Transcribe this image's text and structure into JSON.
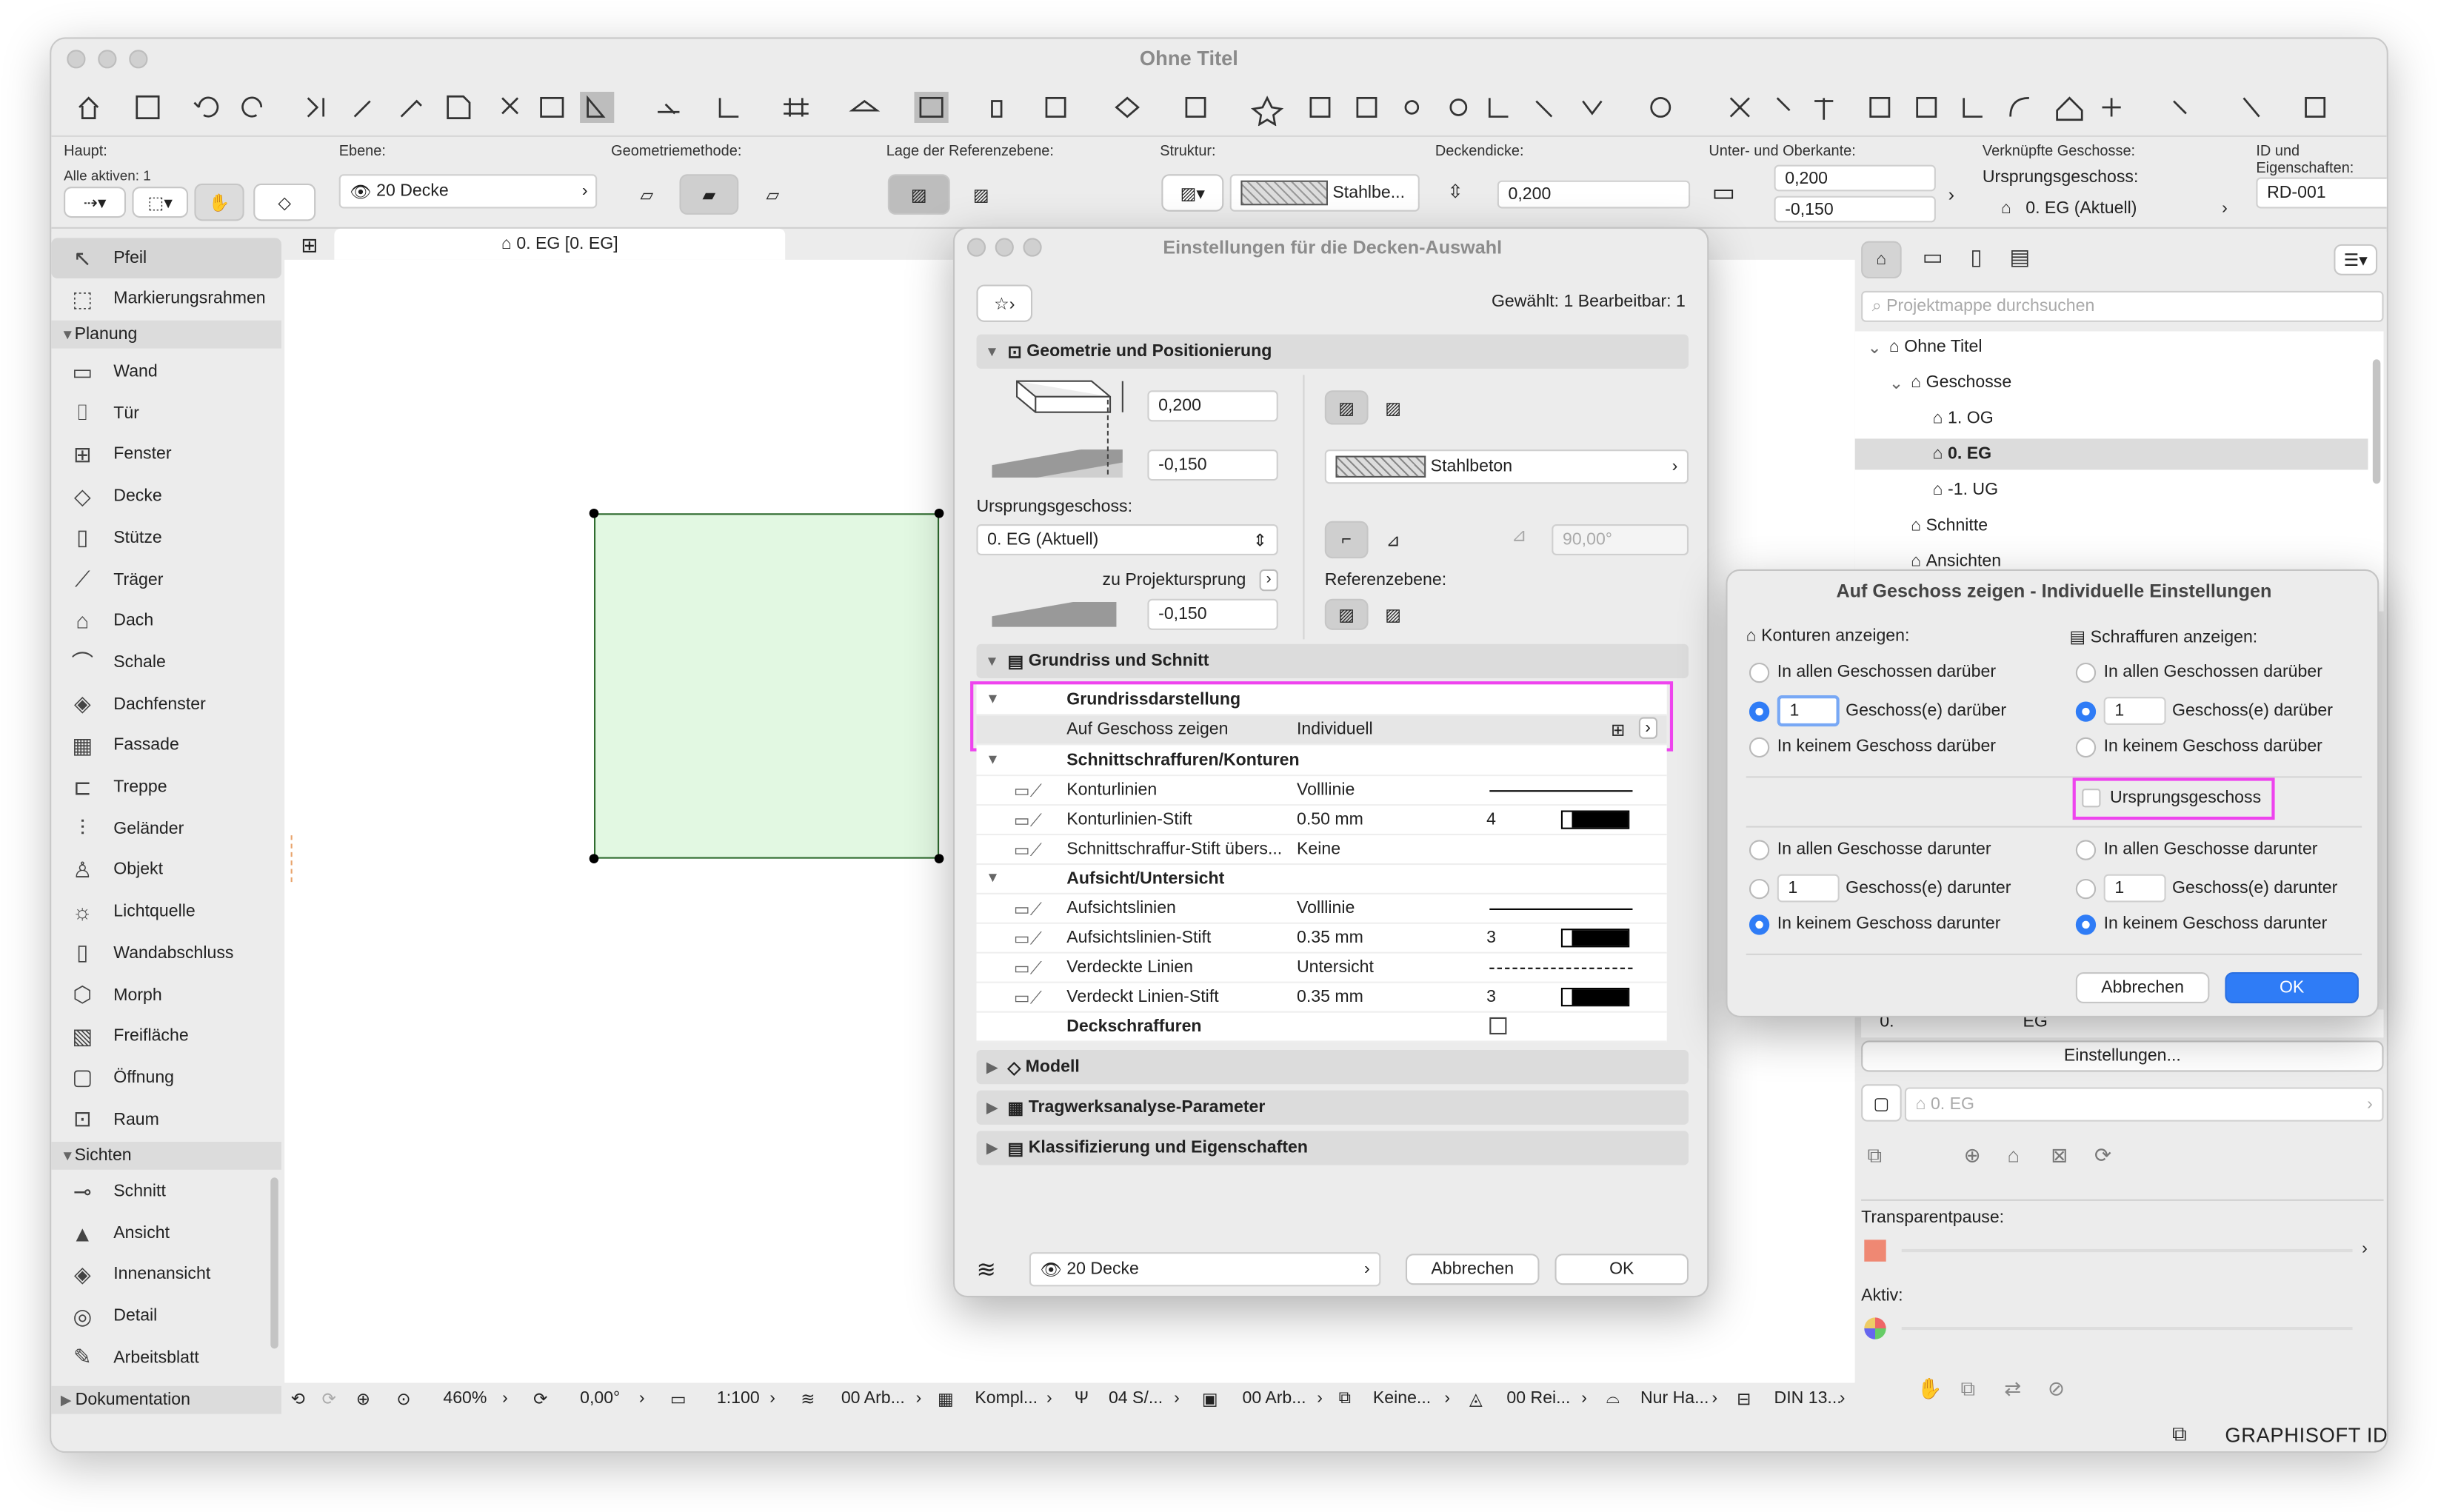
{
  "window": {
    "title": "Ohne Titel"
  },
  "infobox": {
    "haupt_label": "Haupt:",
    "alle_aktiven": "Alle aktiven: 1",
    "ebene_label": "Ebene:",
    "ebene_value": "20 Decke",
    "geometriemethode_label": "Geometriemethode:",
    "referenzebene_label": "Lage der Referenzebene:",
    "struktur_label": "Struktur:",
    "struktur_value": "Stahlbe...",
    "deckendicke_label": "Deckendicke:",
    "deckendicke_value": "0,200",
    "unterober_label": "Unter- und Oberkante:",
    "oberkante": "0,200",
    "unterkante": "-0,150",
    "verkn_label": "Verknüpfte Geschosse:",
    "ursprung_label": "Ursprungsgeschoss:",
    "ursprung_value": "0. EG (Aktuell)",
    "id_label": "ID und Eigenschaften:",
    "id_value": "RD-001"
  },
  "toolbox": {
    "items_top": [
      {
        "label": "Pfeil",
        "icon": "arrow-icon"
      },
      {
        "label": "Markierungsrahmen",
        "icon": "marquee-icon"
      }
    ],
    "planung_header": "Planung",
    "planung": [
      {
        "label": "Wand",
        "icon": "wall-icon"
      },
      {
        "label": "Tür",
        "icon": "door-icon"
      },
      {
        "label": "Fenster",
        "icon": "window-icon"
      },
      {
        "label": "Decke",
        "icon": "slab-icon"
      },
      {
        "label": "Stütze",
        "icon": "column-icon"
      },
      {
        "label": "Träger",
        "icon": "beam-icon"
      },
      {
        "label": "Dach",
        "icon": "roof-icon"
      },
      {
        "label": "Schale",
        "icon": "shell-icon"
      },
      {
        "label": "Dachfenster",
        "icon": "skylight-icon"
      },
      {
        "label": "Fassade",
        "icon": "curtain-wall-icon"
      },
      {
        "label": "Treppe",
        "icon": "stair-icon"
      },
      {
        "label": "Geländer",
        "icon": "railing-icon"
      },
      {
        "label": "Objekt",
        "icon": "object-icon"
      },
      {
        "label": "Lichtquelle",
        "icon": "lamp-icon"
      },
      {
        "label": "Wandabschluss",
        "icon": "wall-end-icon"
      },
      {
        "label": "Morph",
        "icon": "morph-icon"
      },
      {
        "label": "Freifläche",
        "icon": "mesh-icon"
      },
      {
        "label": "Öffnung",
        "icon": "opening-icon"
      },
      {
        "label": "Raum",
        "icon": "zone-icon"
      }
    ],
    "sichten_header": "Sichten",
    "sichten": [
      {
        "label": "Schnitt",
        "icon": "section-icon"
      },
      {
        "label": "Ansicht",
        "icon": "elevation-icon"
      },
      {
        "label": "Innenansicht",
        "icon": "interior-elevation-icon"
      },
      {
        "label": "Detail",
        "icon": "detail-icon"
      },
      {
        "label": "Arbeitsblatt",
        "icon": "worksheet-icon"
      }
    ],
    "dokumentation_header": "Dokumentation"
  },
  "tab": {
    "label": "0. EG [0. EG]"
  },
  "status": {
    "zoom": "460%",
    "angle": "0,00°",
    "scale": "1:100",
    "layer": "00 Arb...",
    "model": "Kompl...",
    "pen": "04 S/...",
    "view": "00 Arb...",
    "renov": "Keine...",
    "struct": "00 Rei...",
    "only": "Nur Ha...",
    "dim": "DIN 13..."
  },
  "settings": {
    "title": "Einstellungen für die Decken-Auswahl",
    "selected": "Gewählt: 1 Bearbeitbar: 1",
    "sec_geom": "Geometrie und Positionierung",
    "thickness": "0,200",
    "bottom": "-0,150",
    "ursprung_label": "Ursprungsgeschoss:",
    "ursprung_value": "0. EG (Aktuell)",
    "projekt": "zu Projektursprung",
    "projekt_value": "-0,150",
    "material": "Stahlbeton",
    "angle": "90,00°",
    "ref_label": "Referenzebene:",
    "sec_grundriss": "Grundriss und Schnitt",
    "grp1": "Grundrissdarstellung",
    "show_label": "Auf Geschoss zeigen",
    "show_value": "Individuell",
    "grp2": "Schnittschraffuren/Konturen",
    "rows2": [
      {
        "l": "Konturlinien",
        "v": "Volllinie",
        "n": ""
      },
      {
        "l": "Konturlinien-Stift",
        "v": "0.50 mm",
        "n": "4"
      },
      {
        "l": "Schnittschraffur-Stift übers...",
        "v": "Keine",
        "n": ""
      }
    ],
    "grp3": "Aufsicht/Untersicht",
    "rows3": [
      {
        "l": "Aufsichtslinien",
        "v": "Volllinie",
        "n": ""
      },
      {
        "l": "Aufsichtslinien-Stift",
        "v": "0.35 mm",
        "n": "3"
      },
      {
        "l": "Verdeckte Linien",
        "v": "Untersicht",
        "n": ""
      },
      {
        "l": "Verdeckt Linien-Stift",
        "v": "0.35 mm",
        "n": "3"
      }
    ],
    "deck": "Deckschraffuren",
    "sec_modell": "Modell",
    "sec_trag": "Tragwerksanalyse-Parameter",
    "sec_klass": "Klassifizierung und Eigenschaften",
    "layer": "20 Decke",
    "cancel": "Abbrechen",
    "ok": "OK"
  },
  "navigator": {
    "search": "Projektmappe durchsuchen",
    "items": [
      {
        "label": "Ohne Titel",
        "indent": 0,
        "bold": false
      },
      {
        "label": "Geschosse",
        "indent": 1,
        "bold": false
      },
      {
        "label": "1. OG",
        "indent": 2,
        "bold": false
      },
      {
        "label": "0. EG",
        "indent": 2,
        "bold": true
      },
      {
        "label": "-1. UG",
        "indent": 2,
        "bold": false
      },
      {
        "label": "Schnitte",
        "indent": 1,
        "bold": false
      },
      {
        "label": "Ansichten",
        "indent": 1,
        "bold": false
      }
    ],
    "prop_label": "0.",
    "prop_value": "EG",
    "einstellungen": "Einstellungen...",
    "eg": "0. EG",
    "transparent": "Transparentpause:",
    "aktiv": "Aktiv:",
    "brand": "GRAPHISOFT ID"
  },
  "dialog2": {
    "title": "Auf Geschoss zeigen - Individuelle Einstellungen",
    "konturen": "Konturen anzeigen:",
    "schraffuren": "Schraffuren anzeigen:",
    "all_above": "In allen Geschossen darüber",
    "n_above": "Geschoss(e) darüber",
    "none_above": "In keinem Geschoss darüber",
    "ursprung": "Ursprungsgeschoss",
    "all_below": "In allen Geschosse darunter",
    "n_below": "Geschoss(e) darunter",
    "none_below": "In keinem Geschoss darunter",
    "val_k_above": "1",
    "val_s_above": "1",
    "val_k_below": "1",
    "val_s_below": "1",
    "cancel": "Abbrechen",
    "ok": "OK"
  }
}
